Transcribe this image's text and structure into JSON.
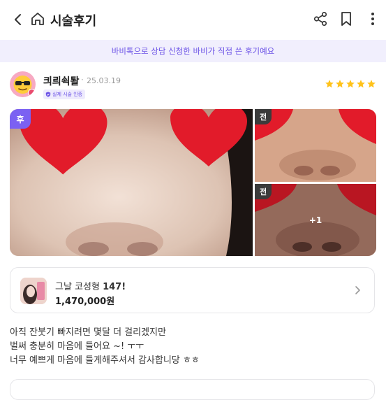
{
  "header": {
    "title": "시술후기",
    "icons": [
      "chevron-left-icon",
      "home-icon",
      "share-icon",
      "bookmark-icon",
      "more-vertical-icon"
    ]
  },
  "banner": {
    "text": "바비톡으로 상담 신청한 바비가 직접 쓴 후기예요"
  },
  "author": {
    "username": "킈릐쇡퇄",
    "separator": "·",
    "date": "25.03.19",
    "verified_label": "실제 시술 인증",
    "rating": 5
  },
  "photos": {
    "after_label": "후",
    "before_label_1": "전",
    "before_label_2": "전",
    "more_count": "+1"
  },
  "product": {
    "name": "그날 코성형",
    "name_suffix": "147!",
    "price": "1,470,000원"
  },
  "review": {
    "lines": [
      "아직 잔붓기 빠지려면 몇달 더 걸리겠지만",
      "벌써 충분히 마음에 들어요 ~! ㅜㅜ",
      "너무 예쁘게 마음에 들게해주셔서 감사합니당 ㅎㅎ"
    ]
  },
  "colors": {
    "accent": "#6b52e6",
    "banner_bg": "#f1effd",
    "star": "#ffc21a",
    "heart": "#e21b2a"
  }
}
